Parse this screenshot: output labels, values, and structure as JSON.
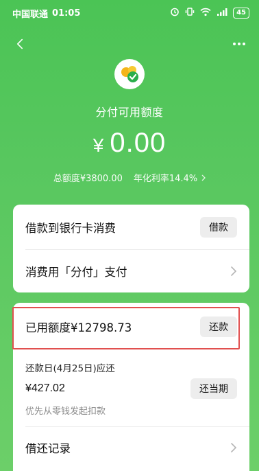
{
  "status_bar": {
    "carrier": "中国联通",
    "time": "01:05",
    "battery": "45"
  },
  "hero": {
    "title": "分付可用额度",
    "currency": "¥",
    "amount": "0.00",
    "total_limit": "总额度¥3800.00",
    "annual_rate": "年化利率14.4%"
  },
  "card1": {
    "loan_label": "借款到银行卡消费",
    "loan_button": "借款",
    "pay_label": "消费用「分付」支付"
  },
  "card2": {
    "used_label": "已用额度¥12798.73",
    "repay_button": "还款",
    "due_label": "还款日(4月25日)应还",
    "due_amount": "¥427.02",
    "repay_current_button": "还当期",
    "hint": "优先从零钱发起扣款",
    "records_label": "借还记录"
  },
  "colors": {
    "brand_green": "#4bc455",
    "highlight_red": "#e1504f"
  }
}
